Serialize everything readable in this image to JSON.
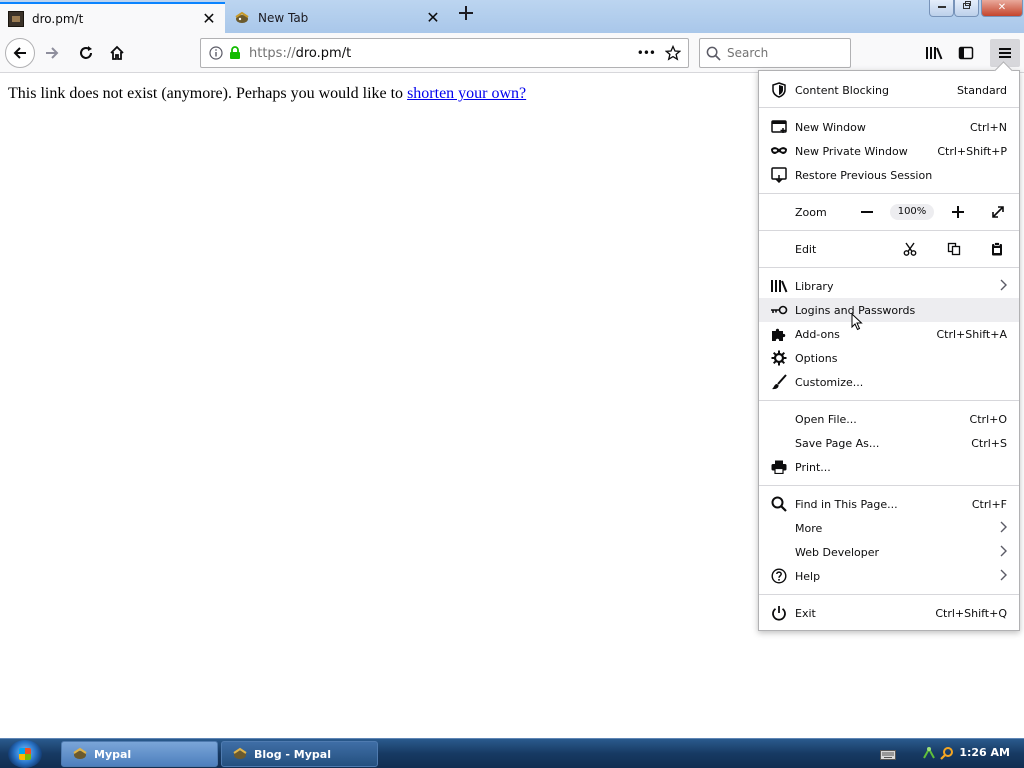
{
  "tabs": [
    {
      "title": "dro.pm/t",
      "active": true
    },
    {
      "title": "New Tab",
      "active": false
    }
  ],
  "window_controls": {
    "close_symbol": "✕"
  },
  "navbar": {
    "url_scheme": "https://",
    "url_host": "dro.pm/t",
    "search_placeholder": "Search",
    "page_actions_symbol": "•••"
  },
  "page": {
    "text_before_link": "This link does not exist (anymore). Perhaps you would like to ",
    "link_text": "shorten your own?"
  },
  "app_menu": {
    "content_blocking": {
      "label": "Content Blocking",
      "value": "Standard"
    },
    "new_window": {
      "label": "New Window",
      "shortcut": "Ctrl+N"
    },
    "new_private_window": {
      "label": "New Private Window",
      "shortcut": "Ctrl+Shift+P"
    },
    "restore_session": {
      "label": "Restore Previous Session"
    },
    "zoom": {
      "label": "Zoom",
      "value": "100%"
    },
    "edit": {
      "label": "Edit"
    },
    "library": {
      "label": "Library"
    },
    "logins": {
      "label": "Logins and Passwords"
    },
    "addons": {
      "label": "Add-ons",
      "shortcut": "Ctrl+Shift+A"
    },
    "options": {
      "label": "Options"
    },
    "customize": {
      "label": "Customize..."
    },
    "open_file": {
      "label": "Open File...",
      "shortcut": "Ctrl+O"
    },
    "save_page": {
      "label": "Save Page As...",
      "shortcut": "Ctrl+S"
    },
    "print": {
      "label": "Print..."
    },
    "find": {
      "label": "Find in This Page...",
      "shortcut": "Ctrl+F"
    },
    "more": {
      "label": "More"
    },
    "web_developer": {
      "label": "Web Developer"
    },
    "help": {
      "label": "Help"
    },
    "exit": {
      "label": "Exit",
      "shortcut": "Ctrl+Shift+Q"
    }
  },
  "taskbar": {
    "buttons": [
      {
        "label": "Mypal",
        "active": true
      },
      {
        "label": "Blog - Mypal",
        "active": false
      }
    ],
    "clock": "1:26 AM"
  },
  "colors": {
    "accent": "#0a84ff",
    "secure_lock": "#12bc00",
    "link": "#0000ee"
  }
}
